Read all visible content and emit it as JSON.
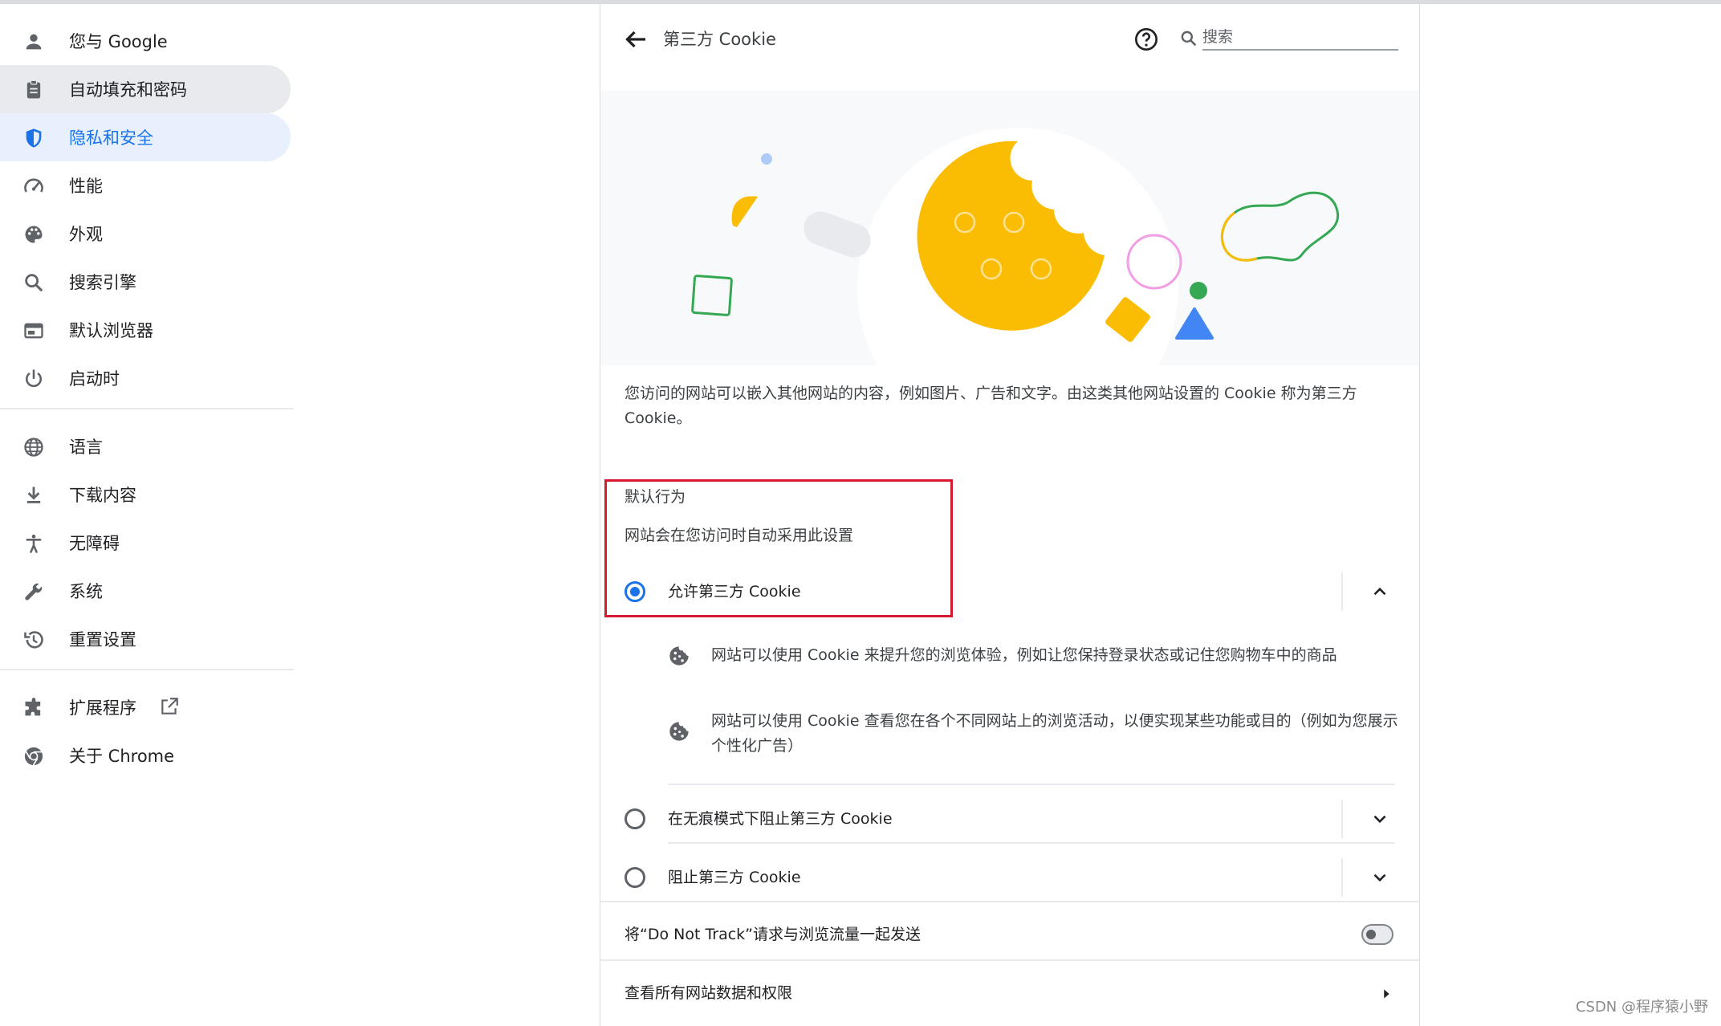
{
  "sidebar": {
    "items": [
      {
        "label": "您与 Google",
        "icon": "person-icon"
      },
      {
        "label": "自动填充和密码",
        "icon": "clipboard-icon"
      },
      {
        "label": "隐私和安全",
        "icon": "shield-icon"
      },
      {
        "label": "性能",
        "icon": "speedometer-icon"
      },
      {
        "label": "外观",
        "icon": "palette-icon"
      },
      {
        "label": "搜索引擎",
        "icon": "search-icon"
      },
      {
        "label": "默认浏览器",
        "icon": "browser-window-icon"
      },
      {
        "label": "启动时",
        "icon": "power-icon"
      }
    ],
    "items2": [
      {
        "label": "语言",
        "icon": "globe-icon"
      },
      {
        "label": "下载内容",
        "icon": "download-icon"
      },
      {
        "label": "无障碍",
        "icon": "accessibility-icon"
      },
      {
        "label": "系统",
        "icon": "wrench-icon"
      },
      {
        "label": "重置设置",
        "icon": "history-icon"
      }
    ],
    "items3": [
      {
        "label": "扩展程序",
        "icon": "puzzle-icon"
      },
      {
        "label": "关于 Chrome",
        "icon": "chrome-icon"
      }
    ]
  },
  "header": {
    "title": "第三方 Cookie",
    "search_placeholder": "搜索"
  },
  "main": {
    "intro": "您访问的网站可以嵌入其他网站的内容，例如图片、广告和文字。由这类其他网站设置的 Cookie 称为第三方 Cookie。",
    "default_title": "默认行为",
    "default_subtitle": "网站会在您访问时自动采用此设置",
    "options": [
      {
        "label": "允许第三方 Cookie",
        "selected": true
      },
      {
        "label": "在无痕模式下阻止第三方 Cookie",
        "selected": false
      },
      {
        "label": "阻止第三方 Cookie",
        "selected": false
      }
    ],
    "details": [
      "网站可以使用 Cookie 来提升您的浏览体验，例如让您保持登录状态或记住您购物车中的商品",
      "网站可以使用 Cookie 查看您在各个不同网站上的浏览活动，以便实现某些功能或目的（例如为您展示个性化广告）"
    ],
    "dnt_label": "将“Do Not Track”请求与浏览流量一起发送",
    "site_data_label": "查看所有网站数据和权限"
  },
  "colors": {
    "accent": "#1a73e8",
    "highlight_border": "#d7192f"
  },
  "watermark": "CSDN @程序猿小野"
}
